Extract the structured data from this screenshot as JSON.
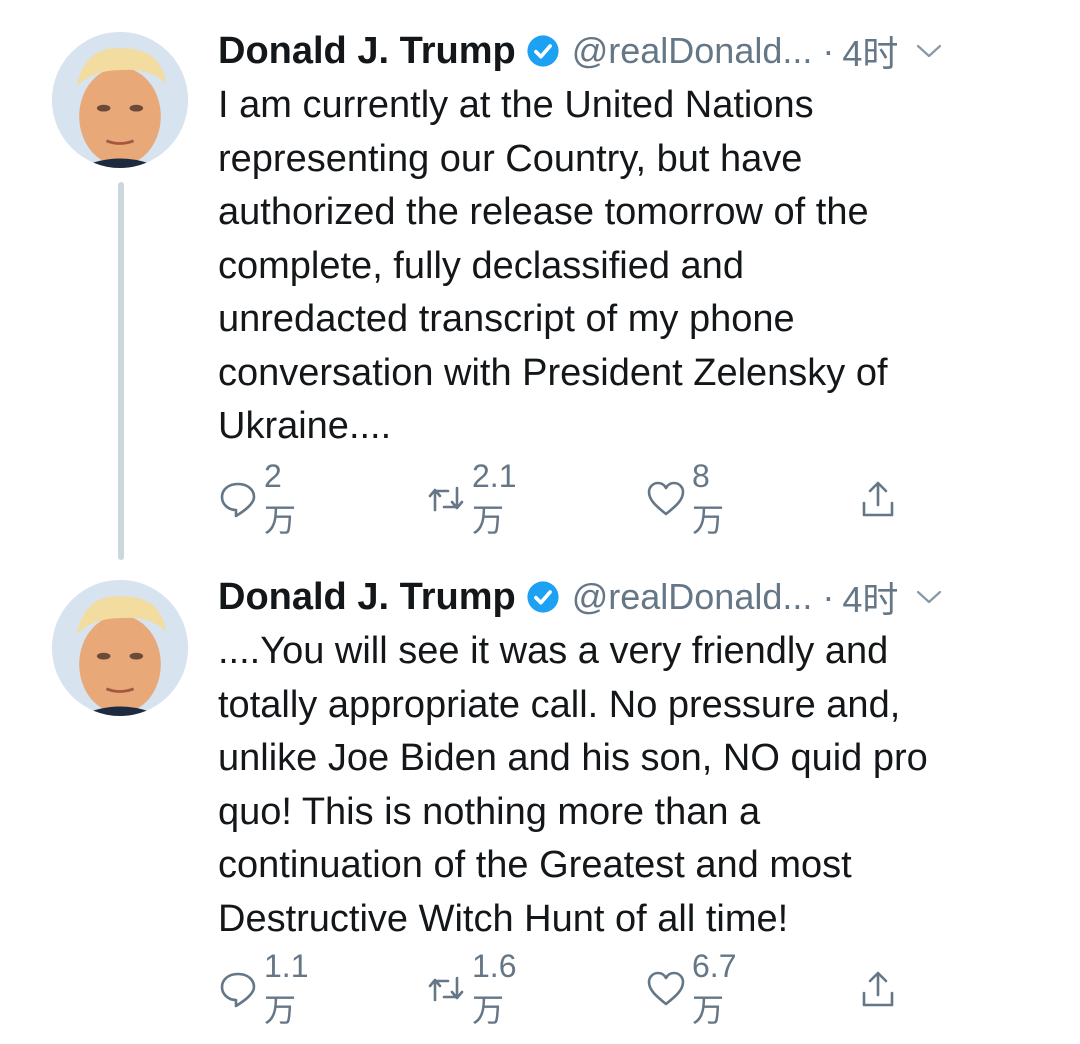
{
  "tweets": [
    {
      "name": "Donald J. Trump",
      "handle": "@realDonald...",
      "dot": "·",
      "time": "4时",
      "lines": [
        "I am currently at the United Nations",
        "representing our Country, but have",
        "authorized the release tomorrow of the",
        "complete, fully declassified and",
        "unredacted transcript of my phone",
        "conversation with President Zelensky of",
        "Ukraine...."
      ],
      "replies": "2万",
      "retweets": "2.1万",
      "likes": "8万"
    },
    {
      "name": "Donald J. Trump",
      "handle": "@realDonald...",
      "dot": "·",
      "time": "4时",
      "lines": [
        "....You will see it was a very friendly and",
        "totally appropriate call. No pressure and,",
        "unlike Joe Biden and his son, NO quid pro",
        "quo! This is nothing more than a",
        "continuation of the Greatest and most",
        "Destructive Witch Hunt of all time!"
      ],
      "replies": "1.1万",
      "retweets": "1.6万",
      "likes": "6.7万"
    }
  ],
  "icons": {
    "verified": "verified-badge-icon",
    "chevron": "chevron-down-icon",
    "reply": "reply-icon",
    "retweet": "retweet-icon",
    "like": "heart-icon",
    "share": "share-icon"
  },
  "colors": {
    "text": "#14171a",
    "muted": "#657786",
    "verified": "#1da1f2",
    "thread_line": "#ccd6dd"
  }
}
